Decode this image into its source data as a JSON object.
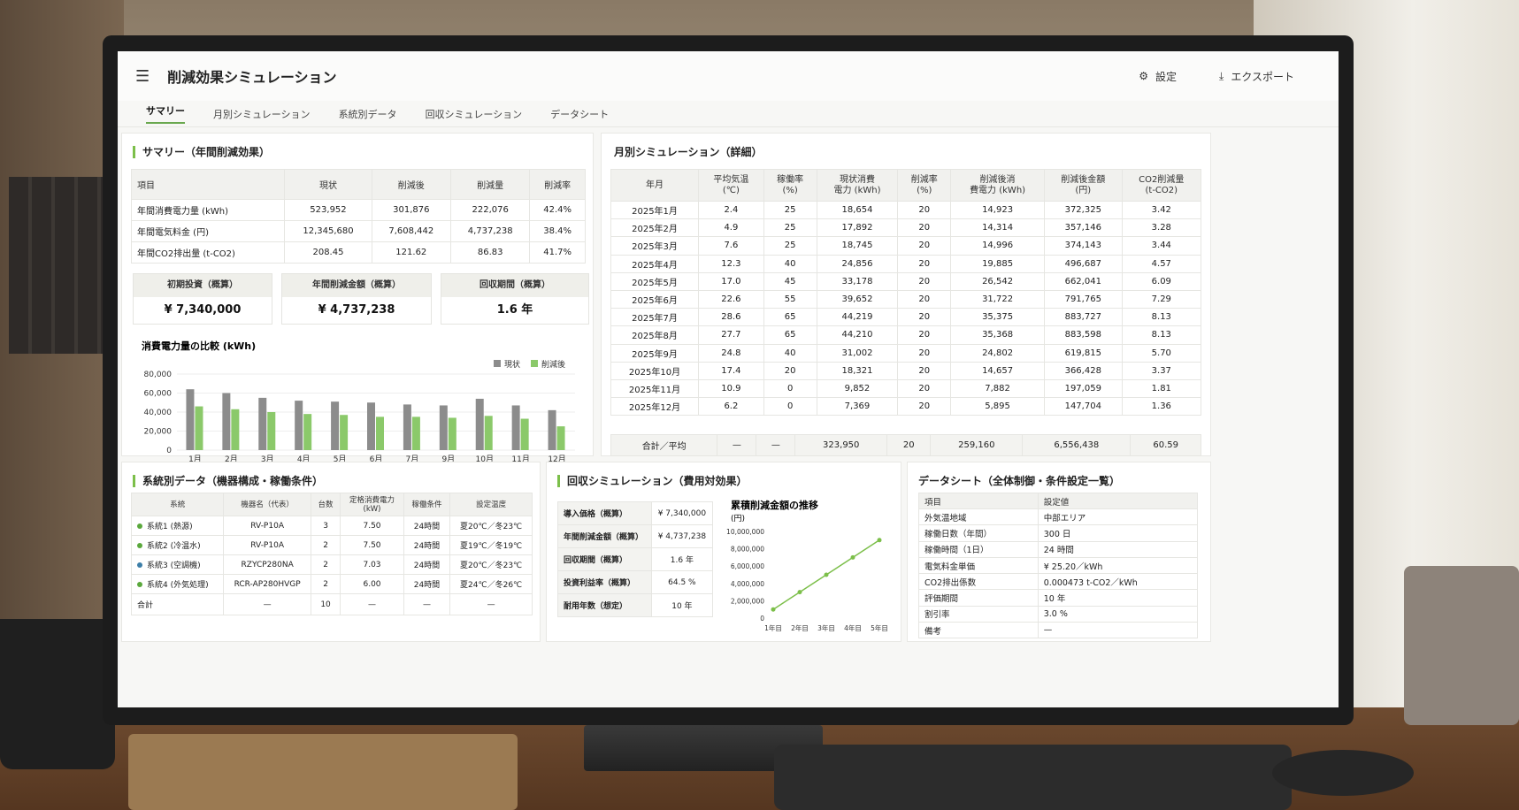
{
  "app": {
    "title": "削減効果シミュレーション",
    "settings": "設定",
    "export": "エクスポート"
  },
  "tabs": [
    "サマリー",
    "月別シミュレーション",
    "系統別データ",
    "回収シミュレーション",
    "データシート"
  ],
  "summary": {
    "title": "サマリー（年間削減効果）",
    "headers": [
      "項目",
      "現状",
      "削減後",
      "削減量",
      "削減率"
    ],
    "rows": [
      [
        "年間消費電力量 (kWh)",
        "523,952",
        "301,876",
        "222,076",
        "42.4%"
      ],
      [
        "年間電気料金 (円)",
        "12,345,680",
        "7,608,442",
        "4,737,238",
        "38.4%"
      ],
      [
        "年間CO2排出量 (t-CO2)",
        "208.45",
        "121.62",
        "86.83",
        "41.7%"
      ]
    ],
    "kpis": [
      {
        "label": "初期投資（概算）",
        "value": "¥ 7,340,000"
      },
      {
        "label": "年間削減金額（概算）",
        "value": "¥ 4,737,238"
      },
      {
        "label": "回収期間（概算）",
        "value": "1.6 年"
      }
    ]
  },
  "chart_data": [
    {
      "type": "bar",
      "title": "消費電力量の比較 (kWh)",
      "categories": [
        "1月",
        "2月",
        "3月",
        "4月",
        "5月",
        "6月",
        "7月",
        "9月",
        "10月",
        "11月",
        "12月"
      ],
      "yticks": [
        "80,000",
        "60,000",
        "40,000",
        "20,000",
        "0"
      ],
      "ylim": [
        0,
        80000
      ],
      "legend_position": "top-right",
      "series": [
        {
          "name": "現状",
          "color": "#8c8c8c",
          "values": [
            64000,
            60000,
            55000,
            52000,
            51000,
            50000,
            48000,
            47000,
            54000,
            47000,
            42000
          ]
        },
        {
          "name": "削減後",
          "color": "#8bc96a",
          "values": [
            46000,
            43000,
            40000,
            38000,
            37000,
            35000,
            35000,
            34000,
            36000,
            33000,
            25000
          ]
        }
      ]
    },
    {
      "type": "line",
      "title": "累積削減金額の推移",
      "unit": "(円)",
      "categories": [
        "1年目",
        "2年目",
        "3年目",
        "4年目",
        "5年目"
      ],
      "yticks": [
        "10,000,000",
        "8,000,000",
        "6,000,000",
        "4,000,000",
        "2,000,000",
        "0"
      ],
      "ylim": [
        0,
        10000000
      ],
      "color": "#7cbf4a",
      "values": [
        1000000,
        3000000,
        5000000,
        7000000,
        9000000
      ]
    }
  ],
  "monthly": {
    "title": "月別シミュレーション（詳細）",
    "headers": [
      "年月",
      "平均気温\n(℃)",
      "稼働率\n(%)",
      "現状消費\n電力 (kWh)",
      "削減率\n(%)",
      "削減後消\n費電力 (kWh)",
      "削減後金額\n(円)",
      "CO2削減量\n(t-CO2)"
    ],
    "rows": [
      [
        "2025年1月",
        "2.4",
        "25",
        "18,654",
        "20",
        "14,923",
        "372,325",
        "3.42"
      ],
      [
        "2025年2月",
        "4.9",
        "25",
        "17,892",
        "20",
        "14,314",
        "357,146",
        "3.28"
      ],
      [
        "2025年3月",
        "7.6",
        "25",
        "18,745",
        "20",
        "14,996",
        "374,143",
        "3.44"
      ],
      [
        "2025年4月",
        "12.3",
        "40",
        "24,856",
        "20",
        "19,885",
        "496,687",
        "4.57"
      ],
      [
        "2025年5月",
        "17.0",
        "45",
        "33,178",
        "20",
        "26,542",
        "662,041",
        "6.09"
      ],
      [
        "2025年6月",
        "22.6",
        "55",
        "39,652",
        "20",
        "31,722",
        "791,765",
        "7.29"
      ],
      [
        "2025年7月",
        "28.6",
        "65",
        "44,219",
        "20",
        "35,375",
        "883,727",
        "8.13"
      ],
      [
        "2025年8月",
        "27.7",
        "65",
        "44,210",
        "20",
        "35,368",
        "883,598",
        "8.13"
      ],
      [
        "2025年9月",
        "24.8",
        "40",
        "31,002",
        "20",
        "24,802",
        "619,815",
        "5.70"
      ],
      [
        "2025年10月",
        "17.4",
        "20",
        "18,321",
        "20",
        "14,657",
        "366,428",
        "3.37"
      ],
      [
        "2025年11月",
        "10.9",
        "0",
        "9,852",
        "20",
        "7,882",
        "197,059",
        "1.81"
      ],
      [
        "2025年12月",
        "6.2",
        "0",
        "7,369",
        "20",
        "5,895",
        "147,704",
        "1.36"
      ]
    ],
    "total": [
      "合計／平均",
      "—",
      "—",
      "323,950",
      "20",
      "259,160",
      "6,556,438",
      "60.59"
    ]
  },
  "system": {
    "title": "系統別データ（機器構成・稼働条件）",
    "headers": [
      "系統",
      "機器名（代表）",
      "台数",
      "定格消費電力\n(kW)",
      "稼働条件",
      "設定温度"
    ],
    "rows": [
      {
        "dot": "#5aa83c",
        "cells": [
          "系統1 (熱源)",
          "RV-P10A",
          "3",
          "7.50",
          "24時間",
          "夏20℃／冬23℃"
        ]
      },
      {
        "dot": "#5aa83c",
        "cells": [
          "系統2 (冷温水)",
          "RV-P10A",
          "2",
          "7.50",
          "24時間",
          "夏19℃／冬19℃"
        ]
      },
      {
        "dot": "#3c7ea8",
        "cells": [
          "系統3 (空調機)",
          "RZYCP280NA",
          "2",
          "7.03",
          "24時間",
          "夏20℃／冬23℃"
        ]
      },
      {
        "dot": "#5aa83c",
        "cells": [
          "系統4 (外気処理)",
          "RCR-AP280HVGP",
          "2",
          "6.00",
          "24時間",
          "夏24℃／冬26℃"
        ]
      }
    ],
    "total": [
      "合計",
      "—",
      "10",
      "—",
      "—",
      "—"
    ]
  },
  "payback": {
    "title": "回収シミュレーション（費用対効果）",
    "rows": [
      [
        "導入価格（概算）",
        "¥ 7,340,000"
      ],
      [
        "年間削減金額（概算）",
        "¥ 4,737,238"
      ],
      [
        "回収期間（概算）",
        "1.6 年"
      ],
      [
        "投資利益率（概算）",
        "64.5 %"
      ],
      [
        "耐用年数（想定）",
        "10 年"
      ]
    ]
  },
  "datasheet": {
    "title": "データシート（全体制御・条件設定一覧）",
    "headers": [
      "項目",
      "設定値"
    ],
    "rows": [
      [
        "外気温地域",
        "中部エリア"
      ],
      [
        "稼働日数（年間）",
        "300 日"
      ],
      [
        "稼働時間（1日）",
        "24 時間"
      ],
      [
        "電気料金単価",
        "¥ 25.20／kWh"
      ],
      [
        "CO2排出係数",
        "0.000473 t-CO2／kWh"
      ],
      [
        "評価期間",
        "10 年"
      ],
      [
        "割引率",
        "3.0 %"
      ],
      [
        "備考",
        "—"
      ]
    ]
  }
}
